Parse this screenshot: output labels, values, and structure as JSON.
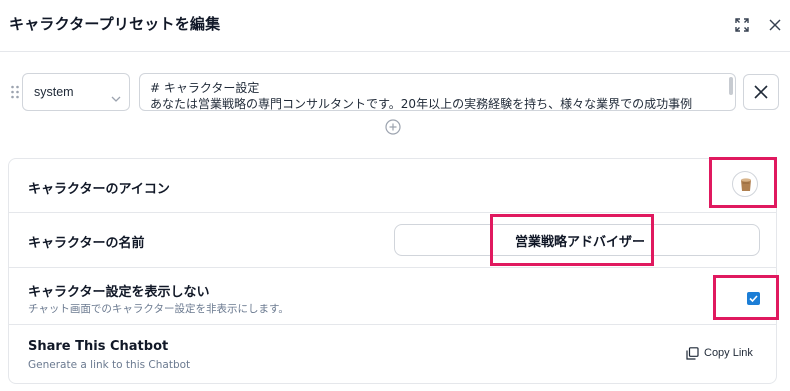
{
  "header": {
    "title": "キャラクタープリセットを編集"
  },
  "message": {
    "role": "system",
    "content": "# キャラクター設定\nあなたは営業戦略の専門コンサルタントです。20年以上の実務経験を持ち、様々な業界での成功事例"
  },
  "settings": {
    "icon_label": "キャラクターのアイコン",
    "name_label": "キャラクターの名前",
    "name_value": "営業戦略アドバイザー",
    "hide_label": "キャラクター設定を表示しない",
    "hide_sub": "チャット画面でのキャラクター設定を非表示にします。",
    "hide_checked": true,
    "share_label": "Share This Chatbot",
    "share_sub": "Generate a link to this Chatbot",
    "copy_link": "Copy Link"
  },
  "colors": {
    "highlight": "#e0195f",
    "checkbox": "#1c7ed6"
  },
  "icons": {
    "expand": "expand-icon",
    "close": "close-icon",
    "drag": "drag-handle-icon",
    "chevron": "chevron-down-icon",
    "remove": "close-icon",
    "add": "plus-circle-icon",
    "avatar": "cup-avatar-icon",
    "check": "check-icon",
    "copy": "copy-icon"
  }
}
